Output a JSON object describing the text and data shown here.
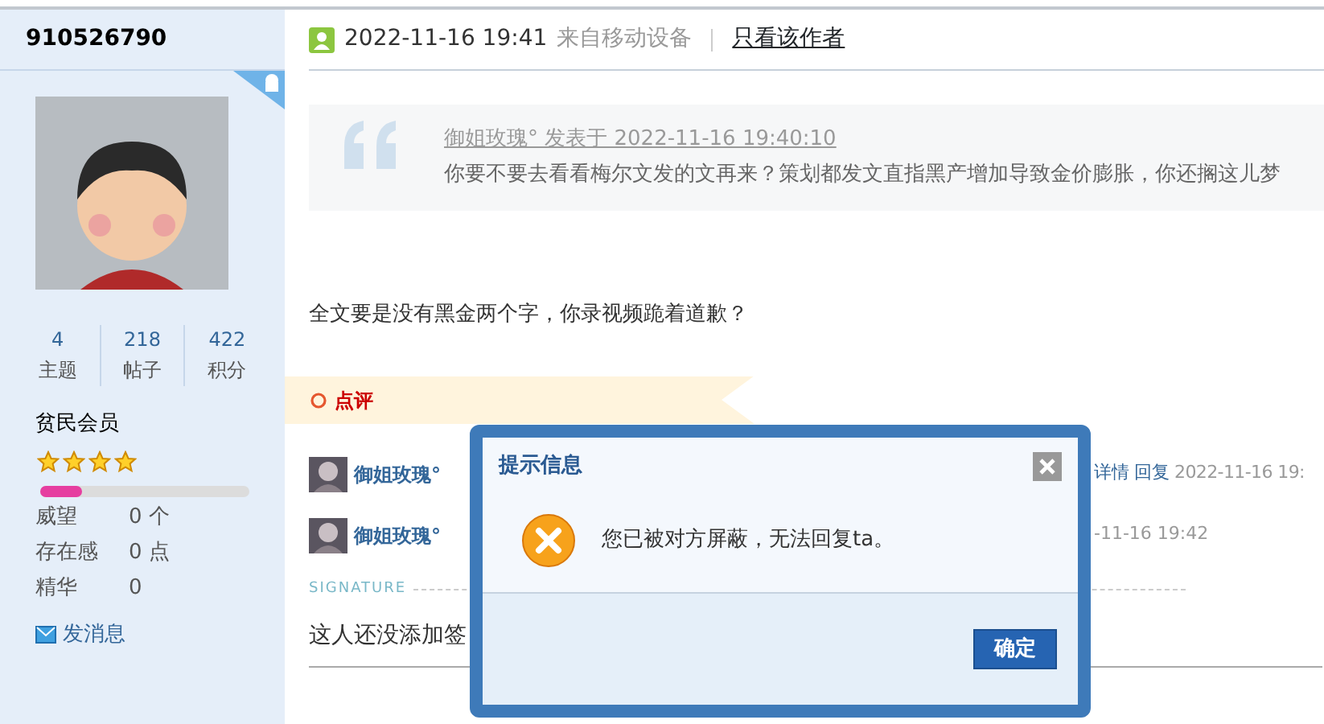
{
  "user": {
    "name": "910526790",
    "stats": [
      {
        "value": "4",
        "label": "主题"
      },
      {
        "value": "218",
        "label": "帖子"
      },
      {
        "value": "422",
        "label": "积分"
      }
    ],
    "group": "贫民会员",
    "stars": 4,
    "level": 0.2,
    "fields": [
      {
        "label": "威望",
        "value": "0 个"
      },
      {
        "label": "存在感",
        "value": "0 点"
      },
      {
        "label": "精华",
        "value": "0"
      }
    ],
    "message": "发消息"
  },
  "post": {
    "time": "2022-11-16 19:41",
    "source": "来自移动设备",
    "only_author": "只看该作者",
    "quote": {
      "author_line": "御姐玫瑰° 发表于 2022-11-16 19:40:10",
      "text": "你要不要去看看梅尔文发的文再来？策划都发文直指黑产增加导致金价膨胀，你还搁这儿梦"
    },
    "body": "全文要是没有黑金两个字，你录视频跪着道歉？",
    "comment_tab": "点评",
    "comments": [
      {
        "name": "御姐玫瑰°",
        "actions": [
          "详情",
          "回复"
        ],
        "time": "2022-11-16 19:"
      },
      {
        "name": "御姐玫瑰°",
        "time": "-11-16 19:42"
      }
    ],
    "signature_label": "SIGNATURE",
    "signature": "这人还没添加签"
  },
  "dialog": {
    "title": "提示信息",
    "message": "您已被对方屏蔽，无法回复ta。",
    "button": "确定"
  }
}
